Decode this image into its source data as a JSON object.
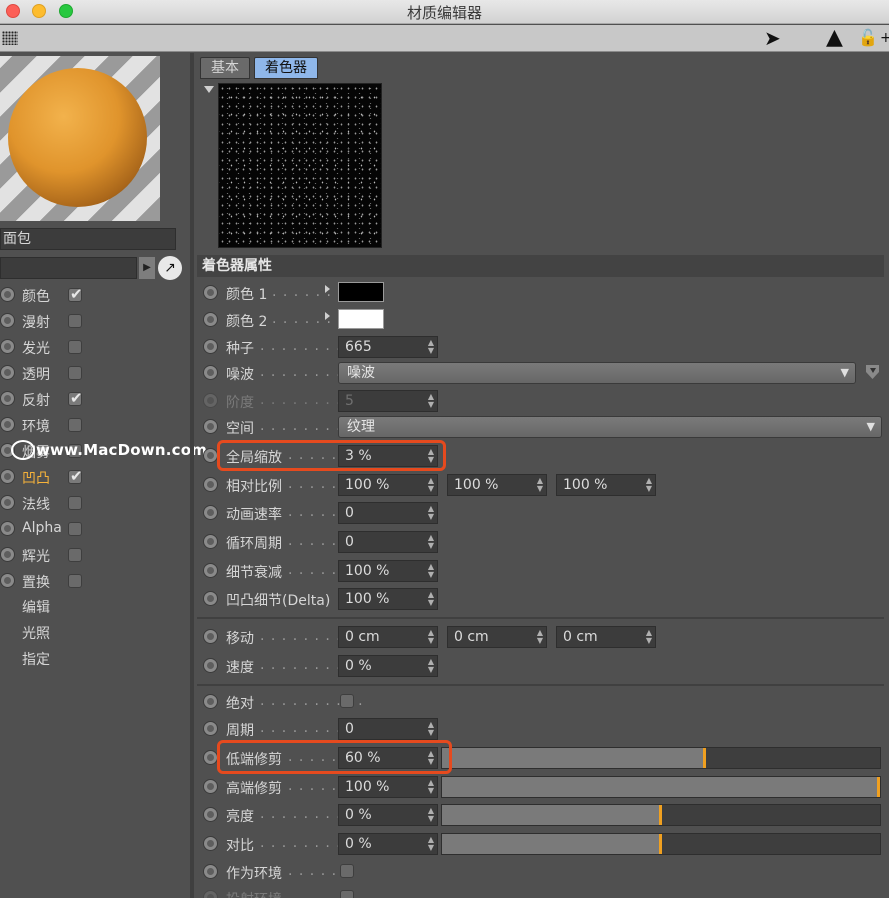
{
  "window": {
    "title": "材质编辑器"
  },
  "left": {
    "material_name": "面包",
    "channels": [
      {
        "label": "颜色",
        "checked": true,
        "active": false
      },
      {
        "label": "漫射",
        "checked": false,
        "active": false
      },
      {
        "label": "发光",
        "checked": false,
        "active": false
      },
      {
        "label": "透明",
        "checked": false,
        "active": false
      },
      {
        "label": "反射",
        "checked": true,
        "active": false
      },
      {
        "label": "环境",
        "checked": false,
        "active": false
      },
      {
        "label": "烟雾",
        "checked": false,
        "active": false
      },
      {
        "label": "凹凸",
        "checked": true,
        "active": true
      },
      {
        "label": "法线",
        "checked": false,
        "active": false
      },
      {
        "label": "Alpha",
        "checked": false,
        "active": false
      },
      {
        "label": "辉光",
        "checked": false,
        "active": false
      },
      {
        "label": "置换",
        "checked": false,
        "active": false
      }
    ],
    "extra": [
      "编辑",
      "光照",
      "指定"
    ],
    "watermark": "www.MacDown.com"
  },
  "tabs": {
    "basic": "基本",
    "shader": "着色器"
  },
  "section_title": "着色器属性",
  "rows": {
    "color1": {
      "label": "颜色 1",
      "value": "#000000"
    },
    "color2": {
      "label": "颜色 2",
      "value": "#ffffff"
    },
    "seed": {
      "label": "种子",
      "value": "665"
    },
    "noise": {
      "label": "噪波",
      "value": "噪波"
    },
    "octaves": {
      "label": "阶度",
      "value": "5"
    },
    "space": {
      "label": "空间",
      "value": "纹理"
    },
    "global_scale": {
      "label": "全局缩放",
      "value": "3 %"
    },
    "relative_scale": {
      "label": "相对比例",
      "v1": "100 %",
      "v2": "100 %",
      "v3": "100 %"
    },
    "anim_speed": {
      "label": "动画速率",
      "value": "0"
    },
    "loop_period": {
      "label": "循环周期",
      "value": "0"
    },
    "detail_atten": {
      "label": "细节衰减",
      "value": "100 %"
    },
    "delta": {
      "label": "凹凸细节(Delta)",
      "value": "100 %"
    },
    "move": {
      "label": "移动",
      "v1": "0 cm",
      "v2": "0 cm",
      "v3": "0 cm"
    },
    "speed": {
      "label": "速度",
      "value": "0 %"
    },
    "absolute": {
      "label": "绝对"
    },
    "cycles": {
      "label": "周期",
      "value": "0"
    },
    "low_clip": {
      "label": "低端修剪",
      "value": "60 %",
      "level": 0.6
    },
    "high_clip": {
      "label": "高端修剪",
      "value": "100 %",
      "level": 1.0
    },
    "brightness": {
      "label": "亮度",
      "value": "0 %",
      "level": 0.5
    },
    "contrast": {
      "label": "对比",
      "value": "0 %",
      "level": 0.5
    },
    "as_env": {
      "label": "作为环境"
    },
    "project_env": {
      "label": "投射环境"
    }
  },
  "colors": {
    "accent": "#f7b33a",
    "highlight": "#e64a1e",
    "tab_active": "#8fb7ea"
  }
}
